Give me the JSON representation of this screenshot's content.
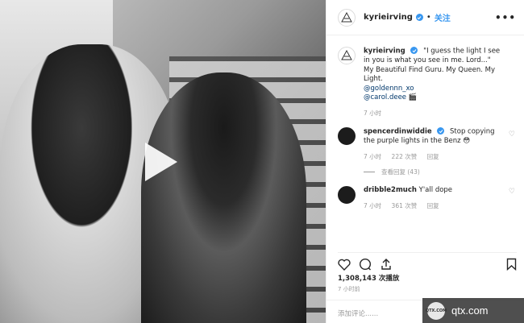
{
  "post": {
    "username": "kyrieirving",
    "follow_label": "关注",
    "separator": "•",
    "more_label": "•••"
  },
  "comments": [
    {
      "username": "kyrieirving",
      "text": "\"I guess the light I see in you is what you see in me. Lord...\" My Beautiful Find Guru. My Queen. My Light.",
      "mention_1": "@goldennn_xo",
      "mention_2": "@carol.deee",
      "time": "7 小时"
    },
    {
      "username": "spencerdinwiddie",
      "text": "Stop copying the purple lights in the Benz",
      "emoji": "😳",
      "time": "7 小时",
      "likes": "222 次赞",
      "reply": "回复"
    },
    {
      "username": "dribble2much",
      "text": "Y'all dope",
      "time": "7 小时",
      "likes": "361 次赞",
      "reply": "回复"
    }
  ],
  "view_replies": "查看回复 (43)",
  "views": "1,308,143 次播放",
  "post_time": "7 小时前",
  "add_comment_placeholder": "添加评论......",
  "watermark": {
    "logo_text": "QTX.COM",
    "text": "qtx.com"
  },
  "colors": {
    "accent": "#3897f0",
    "text": "#262626",
    "muted": "#999999"
  },
  "icons": [
    "instagram-logo-icon",
    "verified-icon",
    "heart-icon",
    "comment-icon",
    "share-icon",
    "bookmark-icon",
    "play-icon"
  ]
}
